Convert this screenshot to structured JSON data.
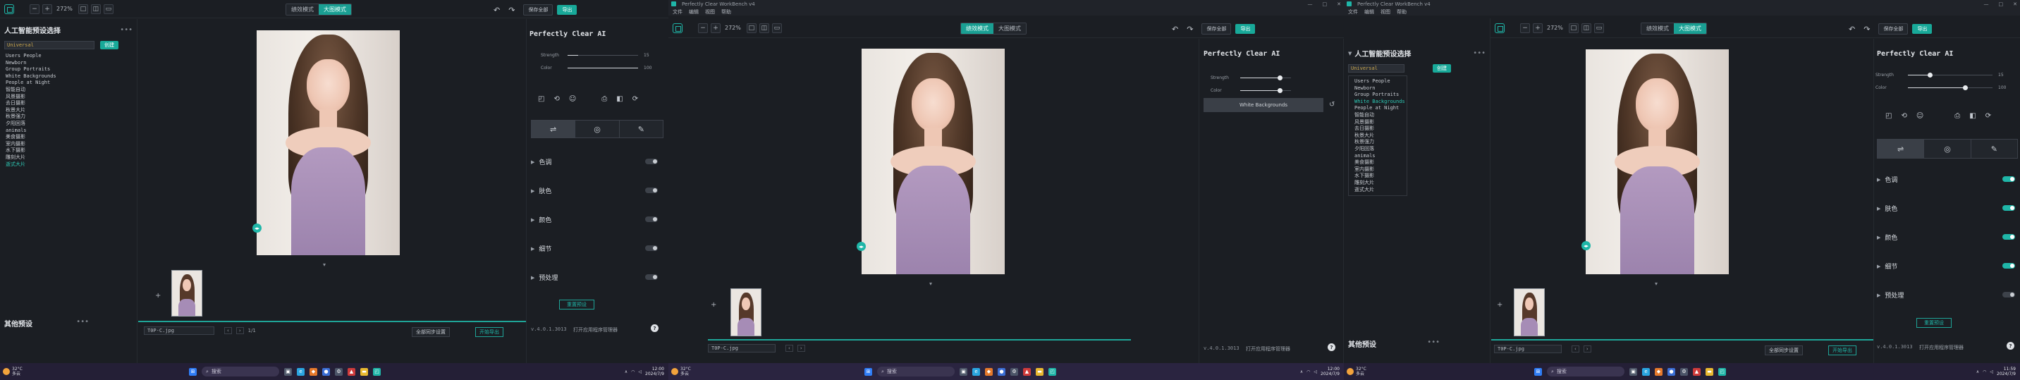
{
  "colors": {
    "accent": "#1fb6a8",
    "export": "#18a999",
    "taskbar": "#241f36",
    "preset_gold": "#c9a64d"
  },
  "app": {
    "window_title": "Perfectly Clear WorkBench v4",
    "menu": [
      "文件",
      "编辑",
      "视图",
      "帮助"
    ]
  },
  "toolbar": {
    "minus": "−",
    "plus": "+",
    "zoom": "272%",
    "mode_preview": "绩效模式",
    "mode_large": "大图模式",
    "undo": "↶",
    "redo": "↷",
    "save_label": "保存全部",
    "export_label": "导出"
  },
  "presets": {
    "heading": "人工智能预设选择",
    "dots": "•••",
    "selected": "Universal",
    "add_label": "创建",
    "items": [
      "Users People",
      "Newborn",
      "Group Portraits",
      "White Backgrounds",
      "People at Night",
      "智能自动",
      "风景摄影",
      "去日摄影",
      "秋景大片",
      "秋景强力",
      "夕阳回落",
      "animals",
      "美食摄影",
      "室内摄影",
      "水下摄影",
      "雕刻大片",
      "逝式大片"
    ],
    "other_heading": "其他预设",
    "other_dots": "•••"
  },
  "canvas": {
    "handle": "◂▸",
    "chevron": "▾"
  },
  "strip": {
    "add": "+",
    "filename": "T0P-C.jpg",
    "prev": "‹",
    "next": "›",
    "count": "1/1",
    "sync_label": "全部同步设置",
    "batch_label": "开始导出"
  },
  "right": {
    "title": "Perfectly Clear AI",
    "strength_label": "Strength",
    "strength_value": "15",
    "color_label": "Color",
    "color_value": "100",
    "tool_icons": [
      "◰",
      "⟲",
      "☺",
      "⎙",
      "◧",
      "⟳"
    ],
    "tab_icons": [
      "⇌",
      "◎",
      "✎"
    ],
    "adjust": [
      {
        "label": "色调"
      },
      {
        "label": "肤色"
      },
      {
        "label": "颜色"
      },
      {
        "label": "细节"
      },
      {
        "label": "预处理"
      }
    ],
    "reset_label": "重置预设",
    "version": "v.4.0.1.3013",
    "open_manager": "打开应用程序管理器",
    "help": "?"
  },
  "mid": {
    "white_bg": "White Backgrounds",
    "undo": "↺"
  },
  "taskbar": {
    "temp": "32°C",
    "weather": "多云",
    "search": "搜索",
    "time1": "12:00",
    "date1": "2024/7/9",
    "time3": "11:59",
    "date3": "2024/7/9"
  }
}
